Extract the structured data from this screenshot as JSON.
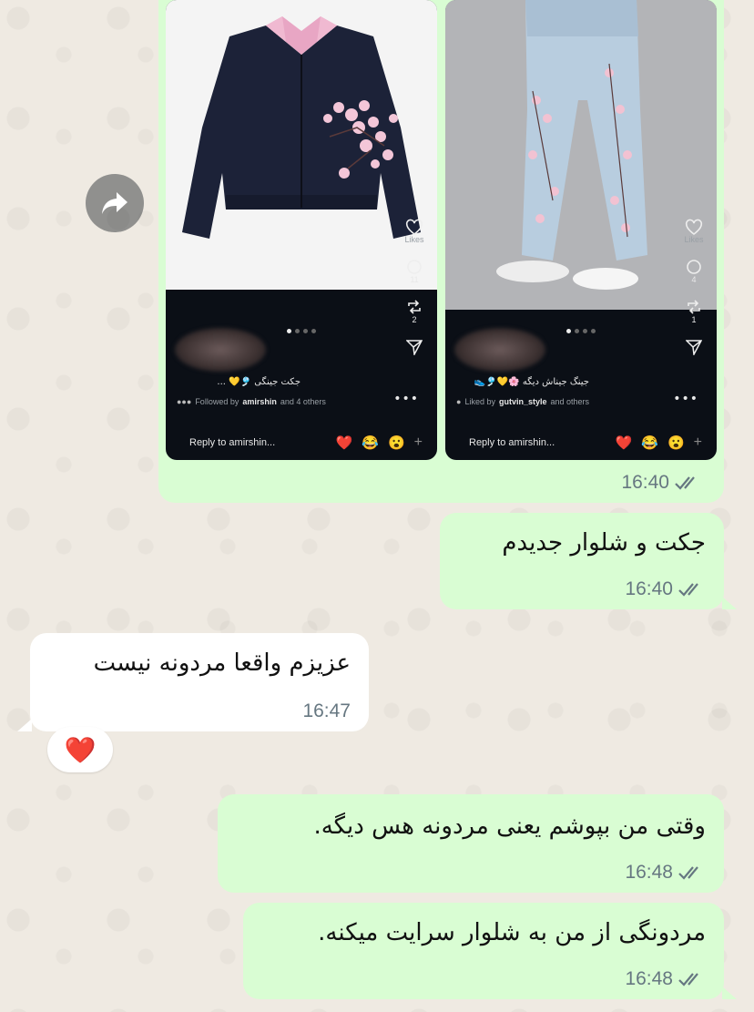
{
  "chat": {
    "messages": [
      {
        "kind": "media",
        "direction": "outgoing",
        "time": "16:40",
        "cards": [
          {
            "image": "black-jacket-pink-collar-cherry-blossom",
            "likes_label": "Likes",
            "comments": "11",
            "reposts": "2",
            "caption": "جکت جینگی 🎐💛 ...",
            "social_prefix": "Followed by",
            "social_user": "amirshin",
            "social_suffix": "and 4 others",
            "reply_placeholder": "Reply to amirshin...",
            "reactions": [
              "❤️",
              "😂",
              "😮",
              "+"
            ]
          },
          {
            "image": "denim-pants-cherry-blossom",
            "likes_label": "Likes",
            "comments": "4",
            "reposts": "1",
            "caption": "جینگ جیناش دیگه 🌸💛🎐👟",
            "social_prefix": "Liked by",
            "social_user": "gutvin_style",
            "social_suffix": "and others",
            "reply_placeholder": "Reply to amirshin...",
            "reactions": [
              "❤️",
              "😂",
              "😮",
              "+"
            ]
          }
        ]
      },
      {
        "kind": "text",
        "direction": "outgoing",
        "text": "جکت و شلوار جدیدم",
        "time": "16:40"
      },
      {
        "kind": "text",
        "direction": "incoming",
        "text": "عزیزم واقعا مردونه نیست",
        "time": "16:47",
        "reaction": "❤️"
      },
      {
        "kind": "text",
        "direction": "outgoing",
        "text": "وقتی من بپوشم یعنی مردونه هس دیگه.",
        "time": "16:48"
      },
      {
        "kind": "text",
        "direction": "outgoing",
        "text": "مردونگی از من به شلوار سرایت میکنه.",
        "time": "16:48"
      }
    ]
  },
  "icons": {
    "forward": "forward-arrow-icon",
    "read_receipt": "double-check-icon"
  },
  "colors": {
    "outgoing_bubble": "#d9fdd3",
    "incoming_bubble": "#ffffff",
    "background": "#efeae2",
    "meta_text": "#667781",
    "read_ticks": "#667781"
  }
}
